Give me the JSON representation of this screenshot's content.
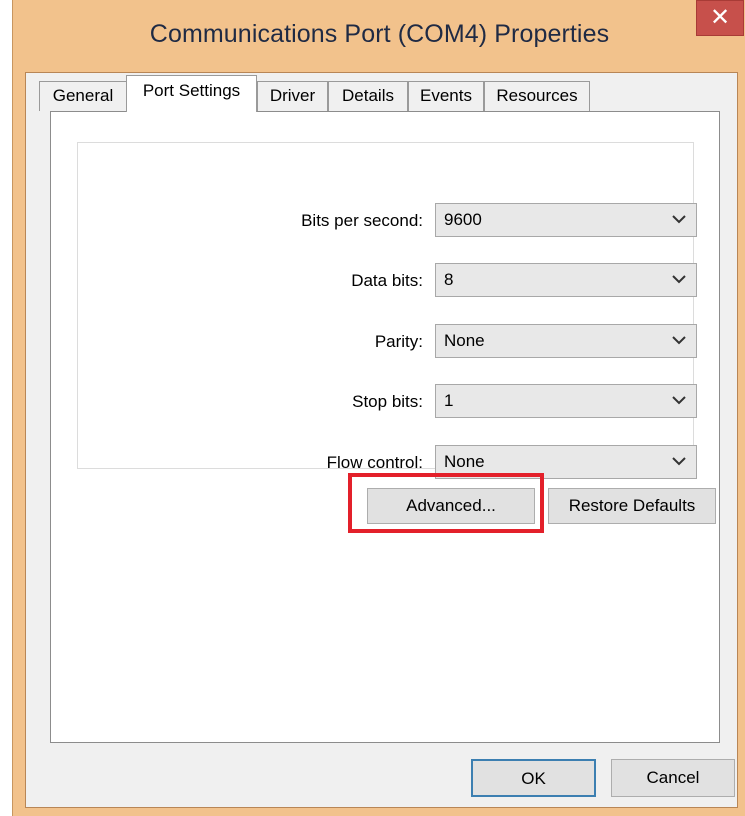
{
  "window": {
    "title": "Communications Port (COM4) Properties",
    "close_glyph": "✕"
  },
  "tabs": [
    {
      "label": "General"
    },
    {
      "label": "Port Settings",
      "active": true
    },
    {
      "label": "Driver"
    },
    {
      "label": "Details"
    },
    {
      "label": "Events"
    },
    {
      "label": "Resources"
    }
  ],
  "port_settings": {
    "fields": [
      {
        "label": "Bits per second:",
        "value": "9600"
      },
      {
        "label": "Data bits:",
        "value": "8"
      },
      {
        "label": "Parity:",
        "value": "None"
      },
      {
        "label": "Stop bits:",
        "value": "1"
      },
      {
        "label": "Flow control:",
        "value": "None"
      }
    ],
    "advanced_label": "Advanced...",
    "restore_label": "Restore Defaults"
  },
  "footer": {
    "ok_label": "OK",
    "cancel_label": "Cancel"
  },
  "colors": {
    "titlebar": "#f2c28c",
    "close": "#c7504b",
    "highlight": "#e3202a",
    "focus_border": "#3c7fb1"
  },
  "icons": {
    "dropdown": "chevron-down-icon",
    "close": "close-icon"
  }
}
